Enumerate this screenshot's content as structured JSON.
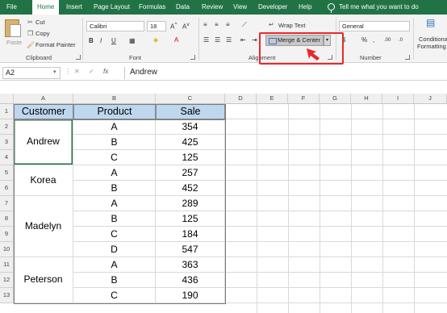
{
  "menu": {
    "tabs": [
      "File",
      "Home",
      "Insert",
      "Page Layout",
      "Formulas",
      "Data",
      "Review",
      "View",
      "Developer",
      "Help"
    ],
    "tell_me": "Tell me what you want to do"
  },
  "ribbon": {
    "clipboard": {
      "label": "Clipboard",
      "paste": "Paste",
      "cut": "Cut",
      "copy": "Copy",
      "format_painter": "Format Painter"
    },
    "font": {
      "label": "Font",
      "font_name": "Calibri",
      "font_size": "18",
      "bold": "B",
      "italic": "I",
      "underline": "U"
    },
    "alignment": {
      "label": "Alignment",
      "wrap_text": "Wrap Text",
      "merge_center": "Merge & Center"
    },
    "number": {
      "label": "Number",
      "format": "General",
      "currency": "$",
      "percent": "%"
    },
    "styles": {
      "conditional": "Conditional",
      "formatting": "Formatting"
    }
  },
  "formula_bar": {
    "name_box": "A2",
    "value": "Andrew"
  },
  "columns": [
    "A",
    "B",
    "C",
    "D",
    "E",
    "F",
    "G",
    "H",
    "I",
    "J"
  ],
  "rows": [
    "1",
    "2",
    "3",
    "4",
    "5",
    "6",
    "7",
    "8",
    "9",
    "10",
    "11",
    "12",
    "13"
  ],
  "table": {
    "headers": [
      "Customer",
      "Product",
      "Sale"
    ],
    "customers": [
      "Andrew",
      "Korea",
      "Madelyn",
      "Peterson"
    ],
    "products": [
      "A",
      "B",
      "C",
      "A",
      "B",
      "A",
      "B",
      "C",
      "D",
      "A",
      "B",
      "C"
    ],
    "sales": [
      "354",
      "425",
      "125",
      "257",
      "452",
      "289",
      "125",
      "184",
      "547",
      "363",
      "436",
      "190"
    ]
  },
  "colors": {
    "excel_green": "#217346",
    "header_fill": "#bdd7ee",
    "highlight_red": "#e8282b"
  }
}
